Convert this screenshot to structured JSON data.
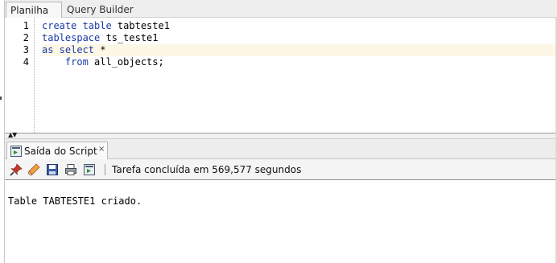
{
  "tabs": [
    {
      "label": "Planilha",
      "active": true
    },
    {
      "label": "Query Builder",
      "active": false
    }
  ],
  "editor": {
    "line_numbers": [
      "1",
      "2",
      "3",
      "4"
    ],
    "current_line_index": 2,
    "lines": [
      [
        {
          "t": "create table",
          "kw": true
        },
        {
          "t": " tabteste1",
          "kw": false
        }
      ],
      [
        {
          "t": "tablespace",
          "kw": true
        },
        {
          "t": " ts_teste1",
          "kw": false
        }
      ],
      [
        {
          "t": "as select",
          "kw": true
        },
        {
          "t": " *",
          "kw": false
        }
      ],
      [
        {
          "t": "    from",
          "kw": true
        },
        {
          "t": " all_objects;",
          "kw": false
        }
      ]
    ]
  },
  "output_panel": {
    "tab_label": "Saída do Script",
    "tab_close": "×",
    "toolbar_icons": [
      "pin-icon",
      "eraser-icon",
      "save-icon",
      "print-icon",
      "export-icon"
    ],
    "status": "Tarefa concluída em 569,577 segundos",
    "content": "Table TABTESTE1 criado."
  },
  "colors": {
    "keyword": "#1a3aa8",
    "current_line": "#fdf8e6",
    "pin": "#c0392b",
    "eraser": "#e08a2c",
    "save": "#3a5fa8"
  }
}
